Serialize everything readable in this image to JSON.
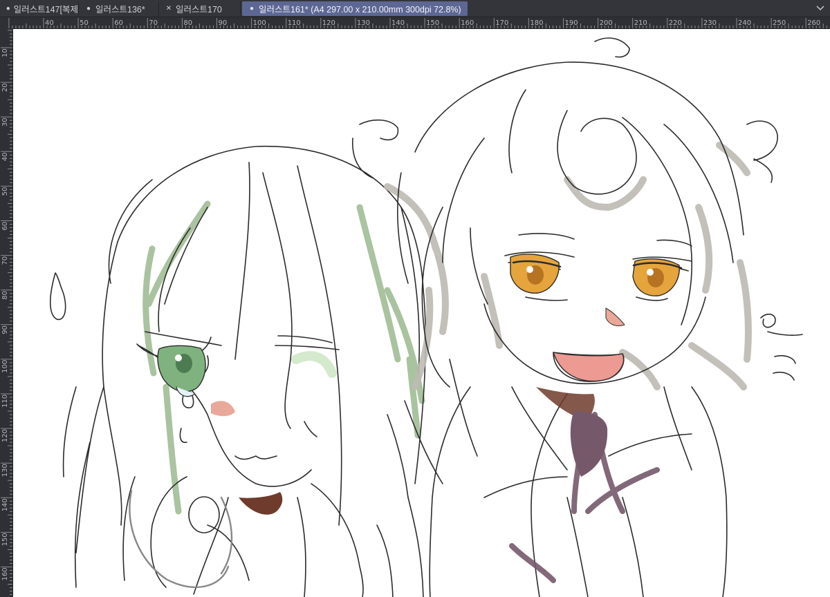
{
  "tabs": [
    {
      "label": "일러스트147[복제",
      "status": "unsaved-dot"
    },
    {
      "label": "일러스트136*",
      "status": "unsaved-dot"
    },
    {
      "label": "일러스트170",
      "status": "close"
    },
    {
      "label": "일러스트161* (A4 297.00 x 210.00mm 300dpi 72.8%)",
      "status": "unsaved-dot",
      "active": true
    }
  ],
  "tab_menu_icon": "chevron-down-icon",
  "horizontal_ruler": [
    "40",
    "50",
    "60",
    "70",
    "80",
    "90",
    "100",
    "110",
    "120",
    "130",
    "140",
    "150",
    "160",
    "170",
    "180",
    "190",
    "200",
    "210",
    "220",
    "230",
    "240",
    "250",
    "260"
  ],
  "vertical_ruler": [
    "10",
    "20",
    "30",
    "40",
    "50",
    "60",
    "70",
    "80",
    "90",
    "100",
    "110",
    "120",
    "130",
    "140",
    "150",
    "160"
  ],
  "colors": {
    "ui_background": "#34353a",
    "active_tab": "#5d6794",
    "ruler": "#2f3035",
    "canvas": "#ffffff",
    "sketch_line": "#2b2b2b",
    "green_hair": "#9bb98f",
    "green_eye": "#76b07a",
    "grey_hair": "#bdbab3",
    "amber_eye": "#e5a53c",
    "mouth": "#ec9a92",
    "blush": "#e9a899",
    "shadow_brown": "#6e3b2c",
    "tie_purple": "#75596b"
  }
}
